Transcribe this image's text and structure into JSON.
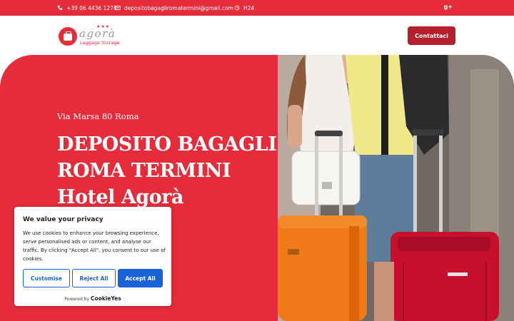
{
  "topbar": {
    "phone": "+39 06 4436 1278",
    "email": "depositobagagliromatermini@gmail.com",
    "hours": "H24",
    "social": "g+"
  },
  "header": {
    "logo_name": "agorà",
    "logo_subtitle": "Luggage Storage",
    "contact_label": "Contattaci"
  },
  "hero": {
    "address": "Via Marsa 80 Roma",
    "title_lines": [
      "DEPOSITO BAGAGLI",
      "ROMA TERMINI",
      "Hotel Agorà"
    ]
  },
  "cookie": {
    "title": "We value your privacy",
    "text": "We use cookies to enhance your browsing experience, serve personalised ads or content, and analyse our traffic. By clicking \"Accept All\", you consent to our use of cookies.",
    "customise_label": "Customise",
    "reject_label": "Reject All",
    "accept_label": "Accept All",
    "powered_prefix": "Powered by",
    "powered_brand": "CookieYes"
  },
  "colors": {
    "brand_red": "#e62b3a",
    "button_dark_red": "#b5202c",
    "cookie_blue": "#1863dc"
  }
}
